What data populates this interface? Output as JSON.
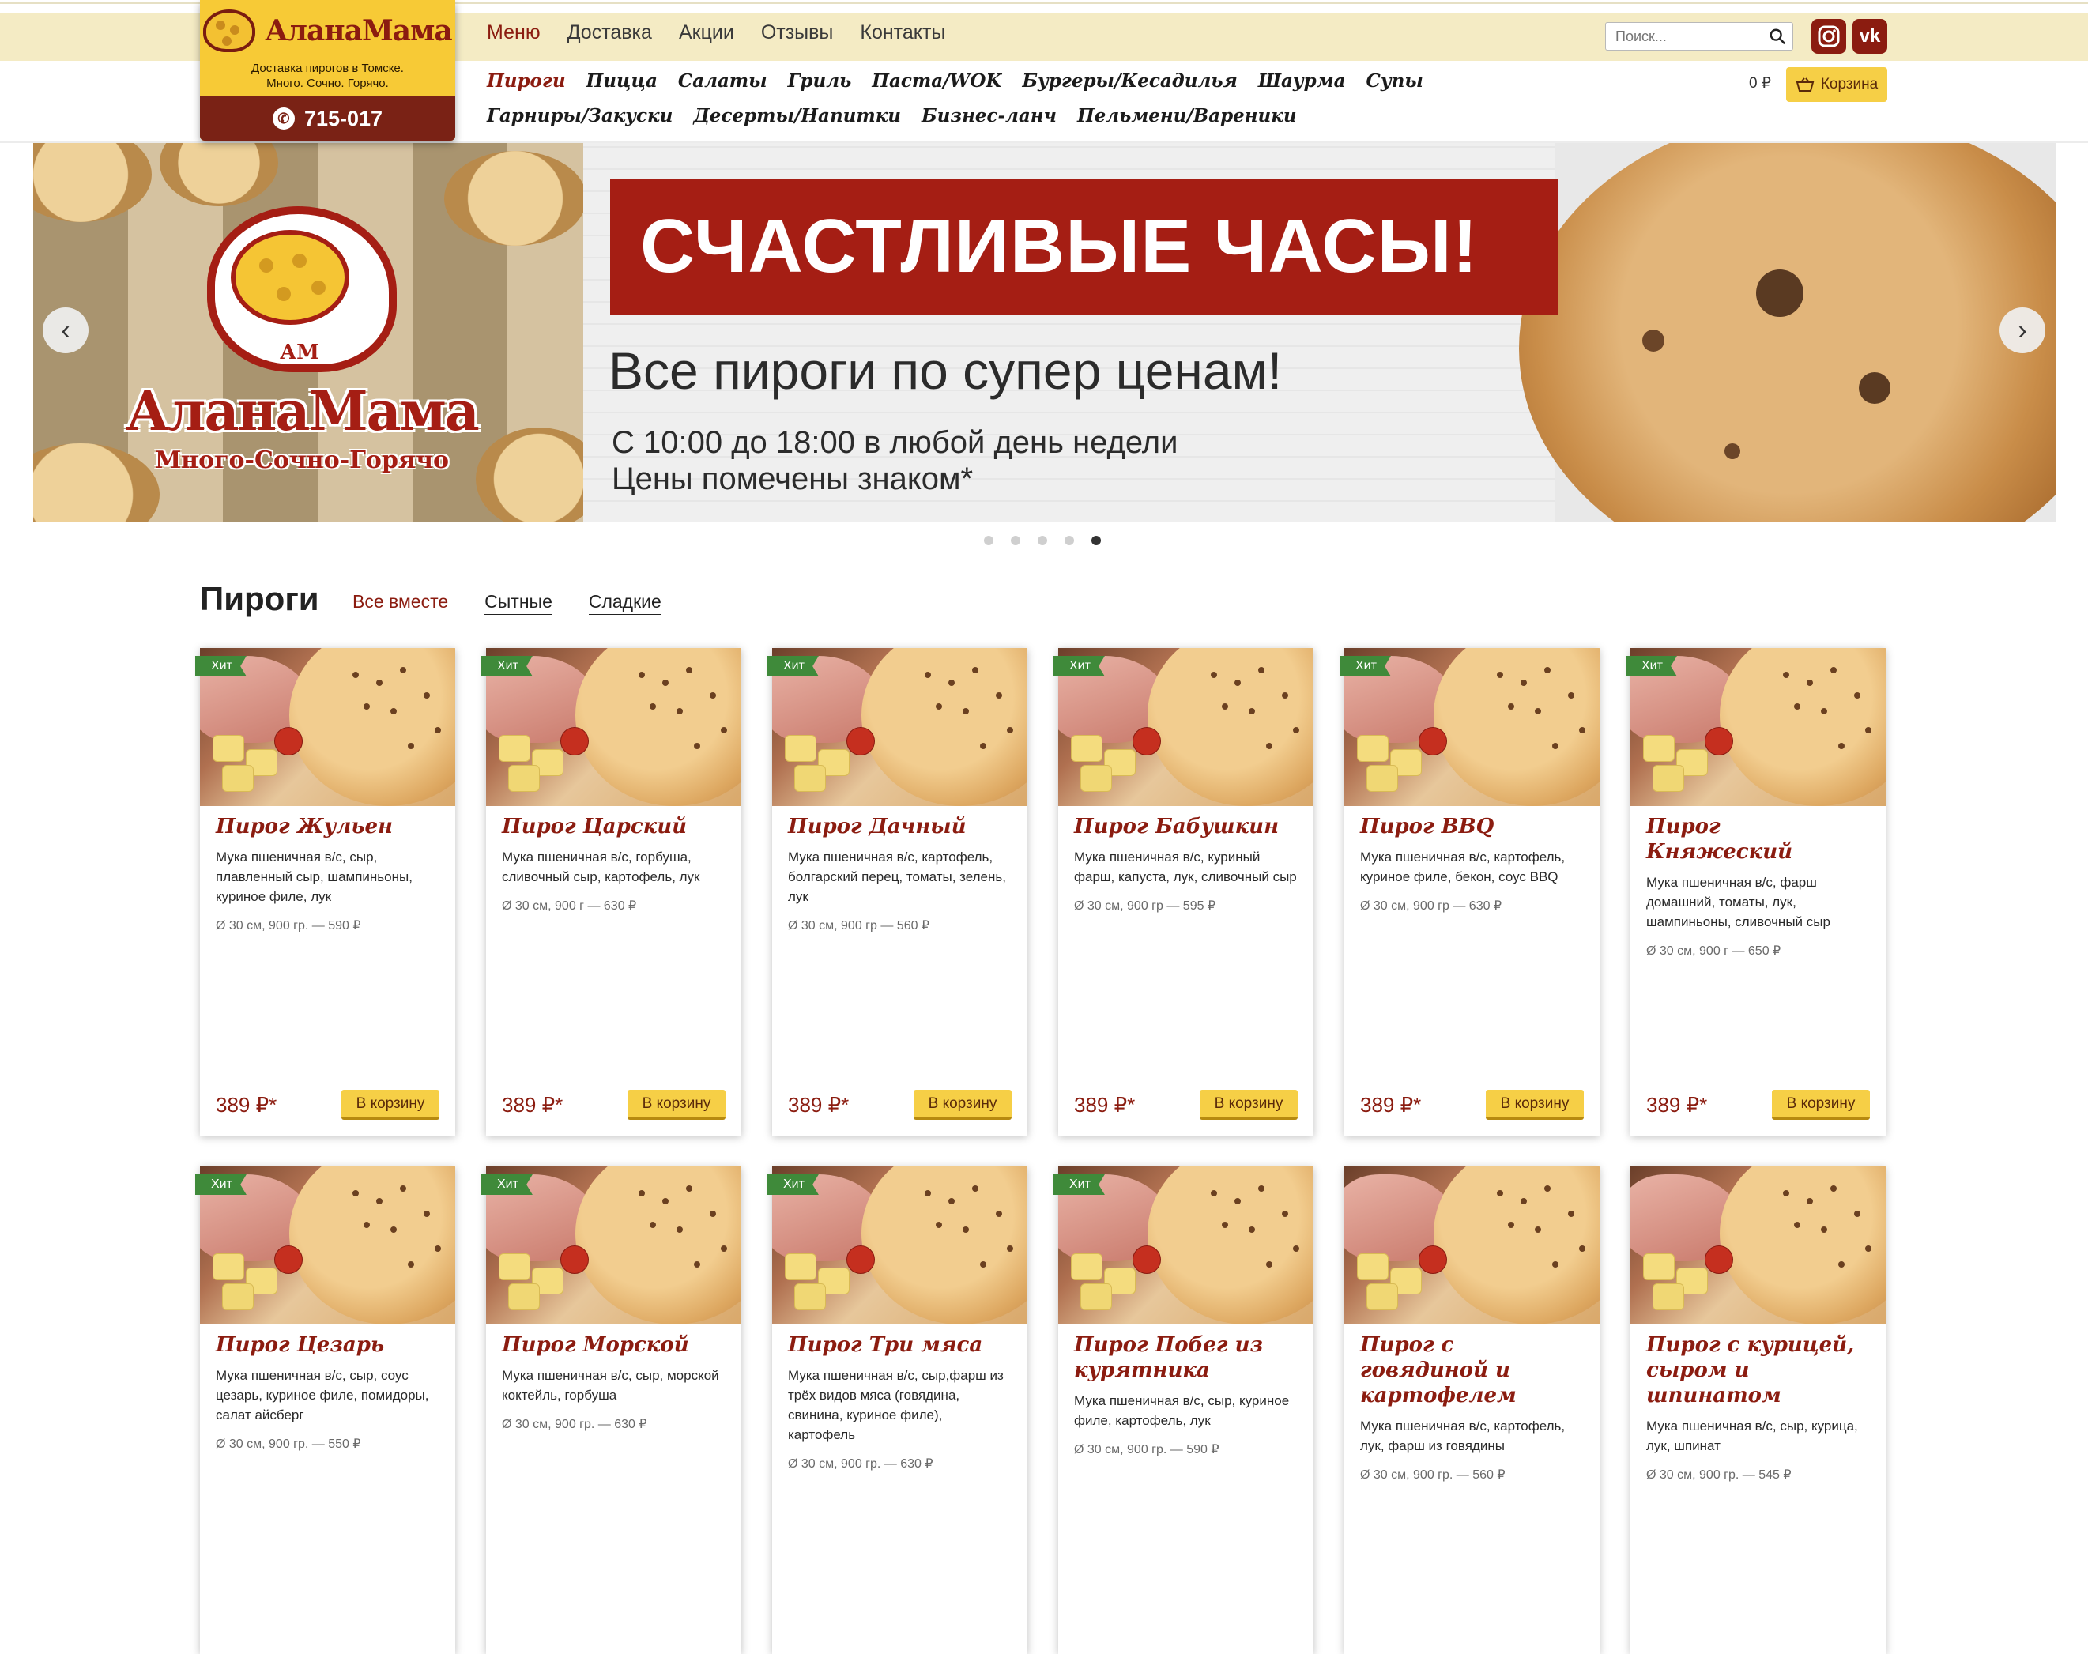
{
  "header": {
    "brand": "АланаМама",
    "tagline_line1": "Доставка пирогов в Томске.",
    "tagline_line2": "Много. Сочно. Горячо.",
    "phone": "715-017",
    "menu": [
      {
        "label": "Меню",
        "active": true
      },
      {
        "label": "Доставка",
        "active": false
      },
      {
        "label": "Акции",
        "active": false
      },
      {
        "label": "Отзывы",
        "active": false
      },
      {
        "label": "Контакты",
        "active": false
      }
    ],
    "search_placeholder": "Поиск...",
    "social": {
      "instagram_icon": "instagram-icon",
      "vk_label": "vk",
      "vk_icon": "vk-icon"
    },
    "categories": [
      {
        "label": "Пироги",
        "active": true
      },
      {
        "label": "Пицца",
        "active": false
      },
      {
        "label": "Салаты",
        "active": false
      },
      {
        "label": "Гриль",
        "active": false
      },
      {
        "label": "Паста/WOK",
        "active": false
      },
      {
        "label": "Бургеры/Кесадилья",
        "active": false
      },
      {
        "label": "Шаурма",
        "active": false
      },
      {
        "label": "Супы",
        "active": false
      },
      {
        "label": "Гарниры/Закуски",
        "active": false
      },
      {
        "label": "Десерты/Напитки",
        "active": false
      },
      {
        "label": "Бизнес-ланч",
        "active": false
      },
      {
        "label": "Пельмени/Вареники",
        "active": false
      }
    ],
    "cart_sum": "0 ₽",
    "cart_label": "Корзина",
    "colors": {
      "accent": "#8b1c10",
      "yellow": "#f6cf46",
      "band": "#f4ebc4"
    }
  },
  "banner": {
    "brand": "АланаМама",
    "brand_mark": "АМ",
    "slogan": "Много-Сочно-Горячо",
    "headline": "СЧАСТЛИВЫЕ ЧАСЫ!",
    "subheadline": "Все пироги по супер ценам!",
    "line1": "С 10:00 до 18:00 в любой день недели",
    "line2": "Цены помечены знаком*",
    "prev_icon": "chevron-left-icon",
    "next_icon": "chevron-right-icon",
    "slides_count": 5,
    "active_slide": 5
  },
  "section": {
    "title": "Пироги",
    "filters": [
      {
        "label": "Все вместе",
        "active": true
      },
      {
        "label": "Сытные",
        "active": false
      },
      {
        "label": "Сладкие",
        "active": false
      }
    ]
  },
  "products": [
    {
      "badge": "Хит",
      "name": "Пирог Жульен",
      "desc": "Мука пшеничная в/с, сыр, плавленный сыр, шампиньоны, куриное филе, лук",
      "meta": "Ø 30 см, 900 гр. — 590 ₽",
      "price": "389 ₽*",
      "button": "В корзину"
    },
    {
      "badge": "Хит",
      "name": "Пирог Царский",
      "desc": "Мука пшеничная в/с, горбуша, сливочный сыр, картофель, лук",
      "meta": "Ø 30 см, 900 г — 630 ₽",
      "price": "389 ₽*",
      "button": "В корзину"
    },
    {
      "badge": "Хит",
      "name": "Пирог Дачный",
      "desc": "Мука пшеничная в/с, картофель, болгарский перец, томаты, зелень, лук",
      "meta": "Ø 30 см, 900 гр — 560 ₽",
      "price": "389 ₽*",
      "button": "В корзину"
    },
    {
      "badge": "Хит",
      "name": "Пирог Бабушкин",
      "desc": "Мука пшеничная в/с, куриный фарш, капуста, лук, сливочный сыр",
      "meta": "Ø 30 см, 900 гр — 595 ₽",
      "price": "389 ₽*",
      "button": "В корзину"
    },
    {
      "badge": "Хит",
      "name": "Пирог BBQ",
      "desc": "Мука пшеничная в/с, картофель, куриное филе, бекон, соус BBQ",
      "meta": "Ø 30 см, 900 гр — 630 ₽",
      "price": "389 ₽*",
      "button": "В корзину"
    },
    {
      "badge": "Хит",
      "name": "Пирог Княжеский",
      "desc": "Мука пшеничная в/с, фарш домашний, томаты, лук, шампиньоны, сливочный сыр",
      "meta": "Ø 30 см, 900 г — 650 ₽",
      "price": "389 ₽*",
      "button": "В корзину"
    },
    {
      "badge": "Хит",
      "name": "Пирог Цезарь",
      "desc": "Мука пшеничная в/с, сыр, соус цезарь, куриное филе, помидоры, салат айсберг",
      "meta": "Ø 30 см, 900 гр. — 550 ₽",
      "price": "",
      "button": ""
    },
    {
      "badge": "Хит",
      "name": "Пирог Морской",
      "desc": "Мука пшеничная в/с, сыр, морской коктейль, горбуша",
      "meta": "Ø 30 см, 900 гр. — 630 ₽",
      "price": "",
      "button": ""
    },
    {
      "badge": "Хит",
      "name": "Пирог Три мяса",
      "desc": "Мука пшеничная в/с, сыр,фарш из трёх видов мяса (говядина, свинина, куриное филе), картофель",
      "meta": "Ø 30 см, 900 гр. — 630 ₽",
      "price": "",
      "button": ""
    },
    {
      "badge": "Хит",
      "name": "Пирог Побег из курятника",
      "desc": "Мука пшеничная в/с, сыр, куриное филе, картофель, лук",
      "meta": "Ø 30 см, 900 гр. — 590 ₽",
      "price": "",
      "button": ""
    },
    {
      "badge": "",
      "name": "Пирог с говядиной и картофелем",
      "desc": "Мука пшеничная в/с, картофель, лук, фарш из говядины",
      "meta": "Ø 30 см, 900 гр. — 560 ₽",
      "price": "",
      "button": ""
    },
    {
      "badge": "",
      "name": "Пирог с курицей, сыром и шпинатом",
      "desc": "Мука пшеничная в/с, сыр, курица, лук, шпинат",
      "meta": "Ø 30 см, 900 гр. — 545 ₽",
      "price": "",
      "button": ""
    }
  ]
}
